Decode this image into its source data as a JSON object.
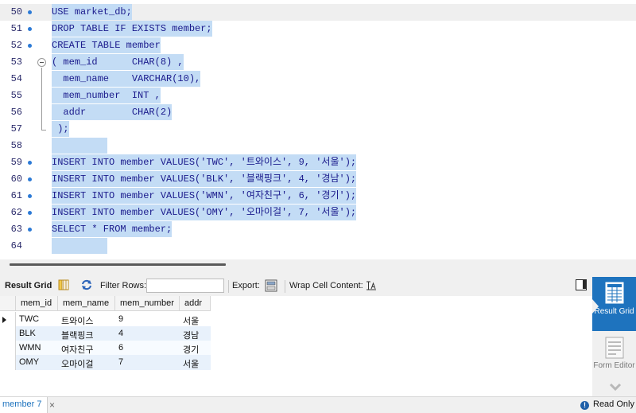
{
  "editor": {
    "lines": [
      {
        "no": "50",
        "text": "USE market_db;"
      },
      {
        "no": "51",
        "text": "DROP TABLE IF EXISTS member;"
      },
      {
        "no": "52",
        "text": "CREATE TABLE member"
      },
      {
        "no": "53",
        "text": "( mem_id      CHAR(8) ,"
      },
      {
        "no": "54",
        "text": "  mem_name    VARCHAR(10),"
      },
      {
        "no": "55",
        "text": "  mem_number  INT ,"
      },
      {
        "no": "56",
        "text": "  addr        CHAR(2)"
      },
      {
        "no": "57",
        "text": " );"
      },
      {
        "no": "58",
        "text": ""
      },
      {
        "no": "59",
        "text": "INSERT INTO member VALUES('TWC', '트와이스', 9, '서울');"
      },
      {
        "no": "60",
        "text": "INSERT INTO member VALUES('BLK', '블랙핑크', 4, '경남');"
      },
      {
        "no": "61",
        "text": "INSERT INTO member VALUES('WMN', '여자친구', 6, '경기');"
      },
      {
        "no": "62",
        "text": "INSERT INTO member VALUES('OMY', '오마이걸', 7, '서울');"
      },
      {
        "no": "63",
        "text": "SELECT * FROM member;"
      },
      {
        "no": "64",
        "text": ""
      }
    ]
  },
  "toolbar": {
    "result_grid_label": "Result Grid",
    "filter_rows_label": "Filter Rows:",
    "filter_rows_value": "",
    "export_label": "Export:",
    "wrap_label": "Wrap Cell Content:"
  },
  "grid": {
    "columns": [
      "mem_id",
      "mem_name",
      "mem_number",
      "addr"
    ],
    "rows": [
      [
        "TWC",
        "트와이스",
        "9",
        "서울"
      ],
      [
        "BLK",
        "블랙핑크",
        "4",
        "경남"
      ],
      [
        "WMN",
        "여자친구",
        "6",
        "경기"
      ],
      [
        "OMY",
        "오마이걸",
        "7",
        "서울"
      ]
    ]
  },
  "side": {
    "result_grid": "Result Grid",
    "form_editor": "Form Editor"
  },
  "status": {
    "tab_label": "member 7",
    "close_glyph": "×",
    "read_only": "Read Only",
    "info_glyph": "!"
  },
  "colors": {
    "selection": "#c3dcf5",
    "accent": "#1e73be",
    "code_text": "#1a1a8c"
  }
}
